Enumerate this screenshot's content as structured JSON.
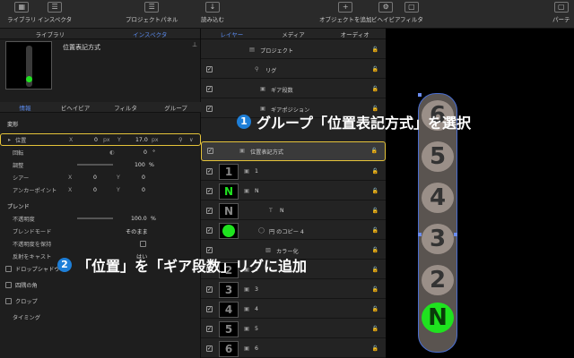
{
  "toolbar": {
    "library": "ライブラリ",
    "inspector": "インスペクタ",
    "project_panel": "プロジェクトパネル",
    "import": "読み込む",
    "add_object": "オブジェクトを追加",
    "behavior": "ビヘイビア",
    "filter": "フィルタ",
    "partial": "パーテ"
  },
  "left_tabs": {
    "library": "ライブラリ",
    "inspector": "インスペクタ"
  },
  "preview_title": "位置表記方式",
  "sub_tabs": [
    "情報",
    "ビヘイビア",
    "フィルタ",
    "グループ"
  ],
  "transform": {
    "section": "変形",
    "position": "位置",
    "x": "X",
    "y": "Y",
    "px_x": "0",
    "px_y": "17.0",
    "unit": "px",
    "rotation": "回転",
    "rot_val": "0",
    "deg": "°",
    "scale": "調整",
    "scale_val": "100",
    "pct": "%",
    "shear": "シアー",
    "shear_x": "0",
    "shear_y": "0",
    "anchor": "アンカーポイント",
    "anc_x": "0",
    "anc_y": "0"
  },
  "blend": {
    "section": "ブレンド",
    "opacity": "不透明度",
    "opacity_val": "100.0",
    "pct": "%",
    "mode": "ブレンドモード",
    "mode_val": "そのまま",
    "keep": "不透明度を保持",
    "cast": "反射をキャスト",
    "cast_val": "はい"
  },
  "options": {
    "drop_shadow": "ドロップシャドウ",
    "corners": "四隅の角",
    "crop": "クロップ",
    "timing": "タイミング"
  },
  "mid_tabs": {
    "layers": "レイヤー",
    "media": "メディア",
    "audio": "オーディオ"
  },
  "layers": [
    {
      "name": "プロジェクト",
      "thumb": ""
    },
    {
      "name": "リグ",
      "thumb": ""
    },
    {
      "name": "ギア段数",
      "thumb": ""
    },
    {
      "name": "ギアポジション",
      "thumb": ""
    },
    {
      "name": "位置表記方式",
      "thumb": ""
    },
    {
      "name": "1",
      "thumb": "1"
    },
    {
      "name": "N",
      "thumb": "N"
    },
    {
      "name": "N",
      "thumb": "N"
    },
    {
      "name": "円 のコピー 4",
      "thumb": ""
    },
    {
      "name": "カラー化",
      "thumb": ""
    },
    {
      "name": "2",
      "thumb": "2"
    },
    {
      "name": "3",
      "thumb": "3"
    },
    {
      "name": "4",
      "thumb": "4"
    },
    {
      "name": "5",
      "thumb": "5"
    },
    {
      "name": "6",
      "thumb": "6"
    }
  ],
  "digits": [
    "6",
    "5",
    "4",
    "3",
    "2",
    "N"
  ],
  "annotations": {
    "n1": "1",
    "t1": "グループ「位置表記方式」を選択",
    "n2": "2",
    "t2": "「位置」を「ギア段数」リグに追加"
  },
  "colors": {
    "accent": "#5b8cf0",
    "highlight": "#e6c43a",
    "green": "#1fe21f",
    "badge": "#1e7fd8"
  }
}
